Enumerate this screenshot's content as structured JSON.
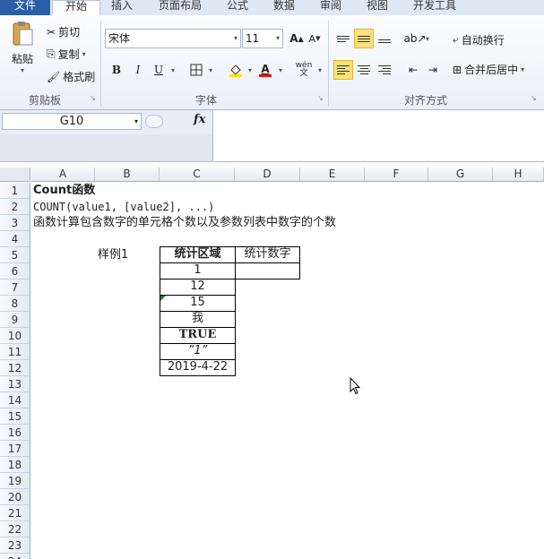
{
  "ribbon_tabs": [
    "文件",
    "开始",
    "插入",
    "页面布局",
    "公式",
    "数据",
    "审阅",
    "视图",
    "开发工具"
  ],
  "clipboard": {
    "paste": "粘贴",
    "cut": "剪切",
    "copy": "复制",
    "format_painter": "格式刷",
    "group": "剪贴板"
  },
  "font": {
    "name": "宋体",
    "size": "11",
    "bold": "B",
    "italic": "I",
    "underline": "U",
    "font_color_glyph": "A",
    "wen": "wén\n文",
    "group": "字体"
  },
  "alignment": {
    "wrap": "自动换行",
    "merge": "合并后居中",
    "group": "对齐方式"
  },
  "formula_bar": {
    "name_box": "G10",
    "fx": "fx",
    "formula": ""
  },
  "columns": [
    "A",
    "B",
    "C",
    "D",
    "E",
    "F",
    "G",
    "H"
  ],
  "rows": [
    "1",
    "2",
    "3",
    "4",
    "5",
    "6",
    "7",
    "8",
    "9",
    "10",
    "11",
    "12",
    "13",
    "14",
    "15",
    "16",
    "17",
    "18",
    "19",
    "20",
    "21",
    "22",
    "23",
    "24"
  ],
  "cells": {
    "A1": "Count函数",
    "A2": "COUNT(value1, [value2], ...)",
    "A3": "函数计算包含数字的单元格个数以及参数列表中数字的个数",
    "B5": "样例1",
    "C5": "统计区域",
    "D5": "统计数字",
    "C6": "1",
    "C7": "12",
    "C8": "15",
    "C9": "我",
    "C10": "TRUE",
    "C11": "”1”",
    "C12": "2019-4-22"
  },
  "colors": {
    "accent": "#2a5ea8",
    "active_button": "#fde27a",
    "error_triangle": "#1f7a3a"
  }
}
